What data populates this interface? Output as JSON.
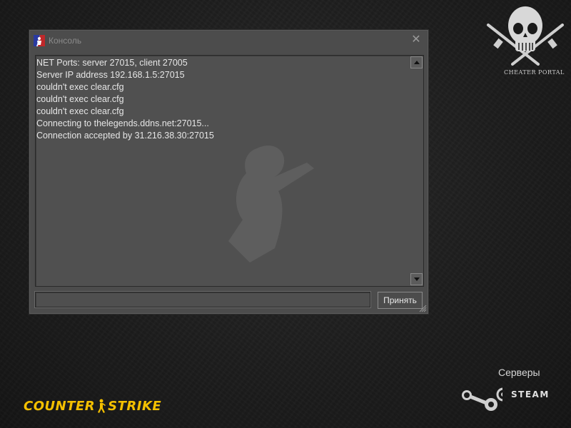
{
  "window": {
    "title": "Консоль",
    "close_glyph": "✕"
  },
  "console": {
    "lines": [
      "NET Ports:  server 27015, client 27005",
      "Server IP address 192.168.1.5:27015",
      "couldn't exec clear.cfg",
      "couldn't exec clear.cfg",
      "couldn't exec clear.cfg",
      "Connecting to thelegends.ddns.net:27015...",
      "Connection accepted by 31.216.38.30:27015"
    ],
    "input_value": "",
    "submit_label": "Принять"
  },
  "branding": {
    "cheater_portal": "CHEATER PORTAL",
    "servers_label": "Серверы",
    "steam_label": "STEAM",
    "cs_part1": "COUNTER",
    "cs_part2": "STRIKE"
  },
  "colors": {
    "cs_yellow": "#f4c000",
    "window_bg": "#4c4c4c"
  }
}
